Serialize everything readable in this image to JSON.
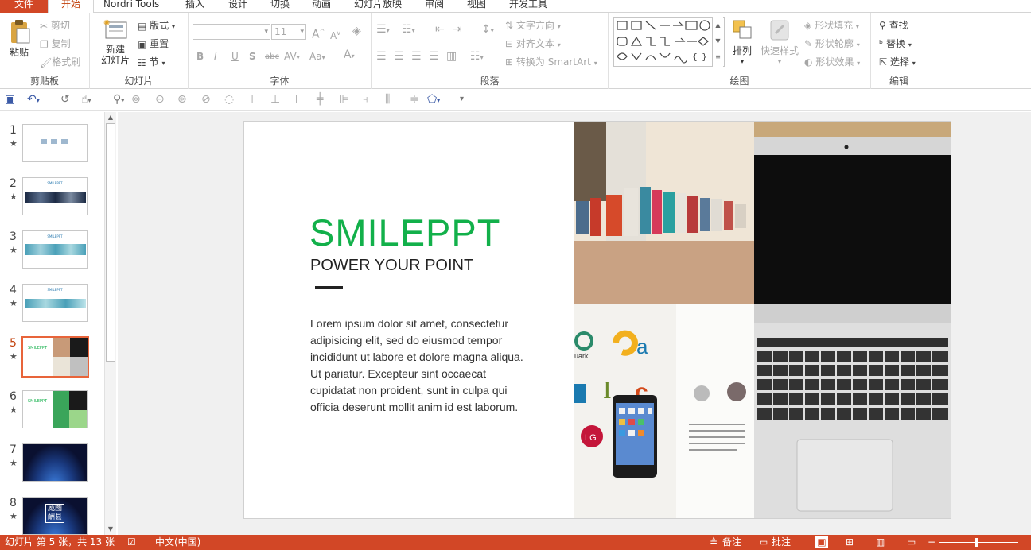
{
  "tabs": [
    "文件",
    "开始",
    "Nordri Tools",
    "插入",
    "设计",
    "切换",
    "动画",
    "幻灯片放映",
    "审阅",
    "视图",
    "开发工具"
  ],
  "ribbon": {
    "clipboard": {
      "paste": "粘贴",
      "cut": "剪切",
      "copy": "复制",
      "format_painter": "格式刷",
      "label": "剪贴板"
    },
    "slides": {
      "new_slide_1": "新建",
      "new_slide_2": "幻灯片",
      "layout": "版式",
      "reset": "重置",
      "section": "节",
      "label": "幻灯片"
    },
    "font": {
      "font_name": "",
      "font_size": "11",
      "bold": "B",
      "italic": "I",
      "underline": "U",
      "shadow": "S",
      "strike": "abc",
      "spacing": "AV",
      "case": "Aa",
      "color": "A",
      "grow": "A",
      "shrink": "A",
      "label": "字体"
    },
    "paragraph": {
      "text_direction": "文字方向",
      "align_text": "对齐文本",
      "convert_smartart": "转换为 SmartArt",
      "label": "段落"
    },
    "drawing": {
      "arrange": "排列",
      "quick_styles": "快速样式",
      "shape_fill": "形状填充",
      "shape_outline": "形状轮廓",
      "shape_effects": "形状效果",
      "label": "绘图"
    },
    "editing": {
      "find": "查找",
      "replace": "替换",
      "select": "选择",
      "label": "编辑"
    }
  },
  "thumbnails": [
    {
      "num": "1",
      "star": "★",
      "selected": false
    },
    {
      "num": "2",
      "star": "★",
      "selected": false
    },
    {
      "num": "3",
      "star": "★",
      "selected": false
    },
    {
      "num": "4",
      "star": "★",
      "selected": false
    },
    {
      "num": "5",
      "star": "★",
      "selected": true
    },
    {
      "num": "6",
      "star": "★",
      "selected": false
    },
    {
      "num": "7",
      "star": "★",
      "selected": false
    },
    {
      "num": "8",
      "star": "★",
      "selected": false
    }
  ],
  "thumb_texts": {
    "t2": "SMILEPPT",
    "t3": "SMILEPPT",
    "t4": "SMILEPPT",
    "t5": "SMILEPPT",
    "t6": "SMILEPPT",
    "t8": "威图 酬县"
  },
  "slide": {
    "title": "SMILEPPT",
    "subtitle": "POWER YOUR POINT",
    "body": "Lorem ipsum dolor sit amet, consectetur adipisicing elit, sed do eiusmod tempor incididunt ut labore et dolore magna aliqua. Ut pariatur. Excepteur sint occaecat cupidatat non proident, sunt in culpa qui officia deserunt mollit anim id est laborum.",
    "accent_color": "#12b04a"
  },
  "status": {
    "slide_info": "幻灯片 第 5 张，共 13 张",
    "language": "中文(中国)",
    "notes": "备注",
    "comments": "批注"
  },
  "colors": {
    "brand": "#d24726",
    "active_tab": "#c2410c"
  }
}
